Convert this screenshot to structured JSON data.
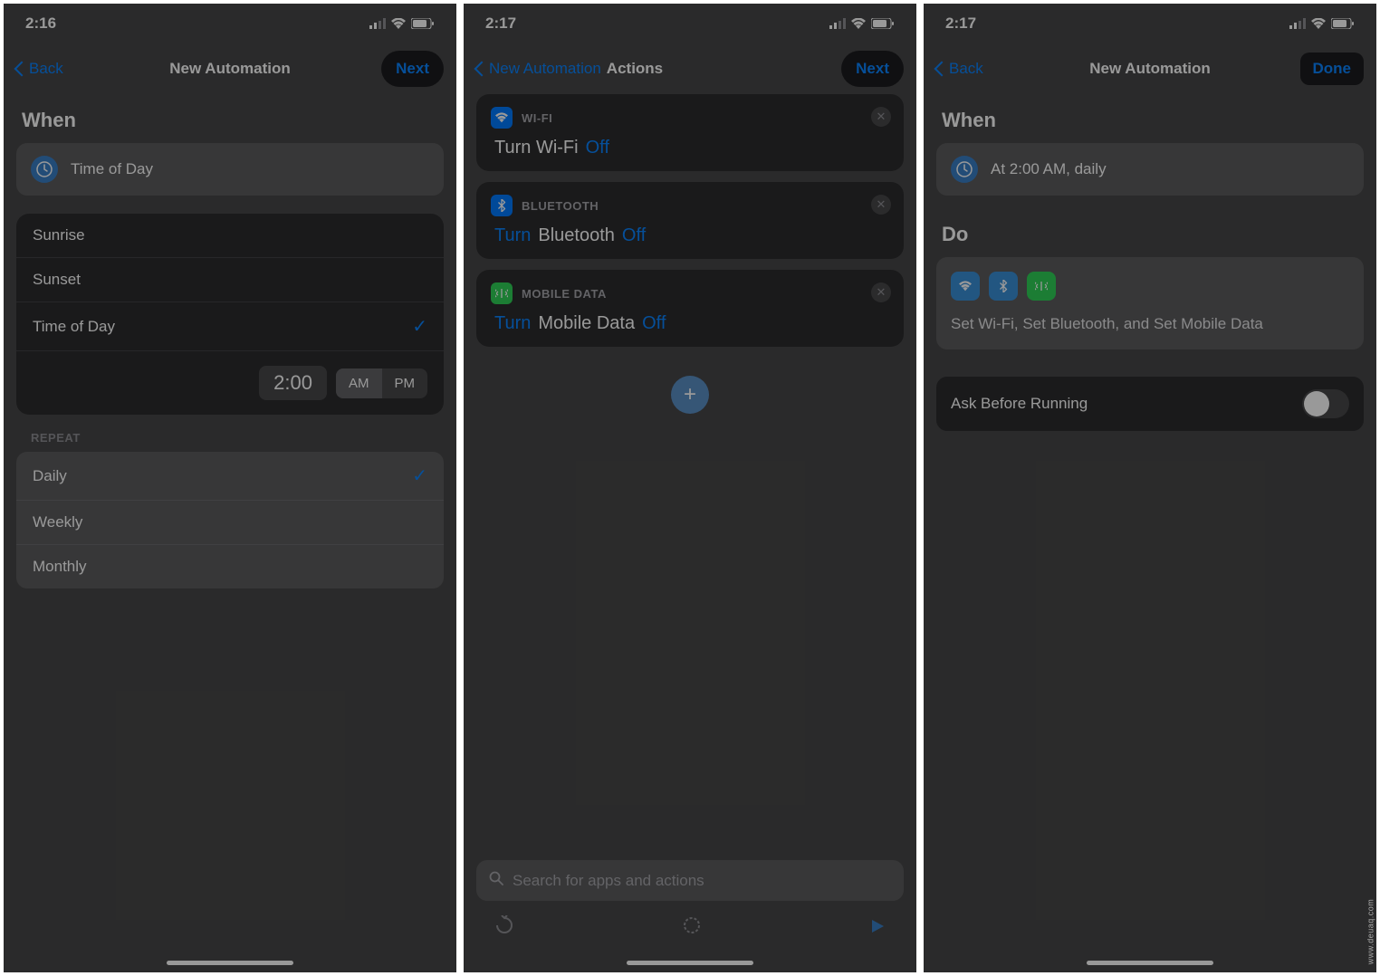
{
  "screen1": {
    "time": "2:16",
    "nav": {
      "back": "Back",
      "title": "New Automation",
      "next": "Next"
    },
    "when": {
      "title": "When",
      "trigger": "Time of Day"
    },
    "popup": {
      "options": [
        "Sunrise",
        "Sunset",
        "Time of Day"
      ],
      "selected_index": 2,
      "time_value": "2:00",
      "am": "AM",
      "pm": "PM"
    },
    "repeat": {
      "label": "REPEAT",
      "options": [
        "Daily",
        "Weekly",
        "Monthly"
      ],
      "selected_index": 0
    }
  },
  "screen2": {
    "time": "2:17",
    "nav": {
      "back": "New Automation",
      "title": "Actions",
      "next": "Next"
    },
    "actions": [
      {
        "icon": "wifi",
        "label": "WI-FI",
        "parts": [
          "Turn Wi-Fi",
          "Off"
        ],
        "link_indices": [
          1
        ],
        "color": "#007aff"
      },
      {
        "icon": "bt",
        "label": "BLUETOOTH",
        "parts": [
          "Turn",
          "Bluetooth",
          "Off"
        ],
        "link_indices": [
          0,
          2
        ],
        "color": "#007aff"
      },
      {
        "icon": "cell",
        "label": "MOBILE DATA",
        "parts": [
          "Turn",
          "Mobile Data",
          "Off"
        ],
        "link_indices": [
          0,
          2
        ],
        "color": "#30d158"
      }
    ],
    "search_placeholder": "Search for apps and actions"
  },
  "screen3": {
    "time": "2:17",
    "nav": {
      "back": "Back",
      "title": "New Automation",
      "done": "Done"
    },
    "when": {
      "title": "When",
      "summary": "At 2:00 AM, daily"
    },
    "do": {
      "title": "Do",
      "summary": "Set Wi-Fi, Set Bluetooth, and Set Mobile Data",
      "icons": [
        {
          "type": "wifi",
          "color": "#3a8fd8"
        },
        {
          "type": "bt",
          "color": "#3a8fd8"
        },
        {
          "type": "cell",
          "color": "#30d158"
        }
      ]
    },
    "ask": {
      "label": "Ask Before Running",
      "value": false
    }
  },
  "watermark": "www.deuaq.com"
}
